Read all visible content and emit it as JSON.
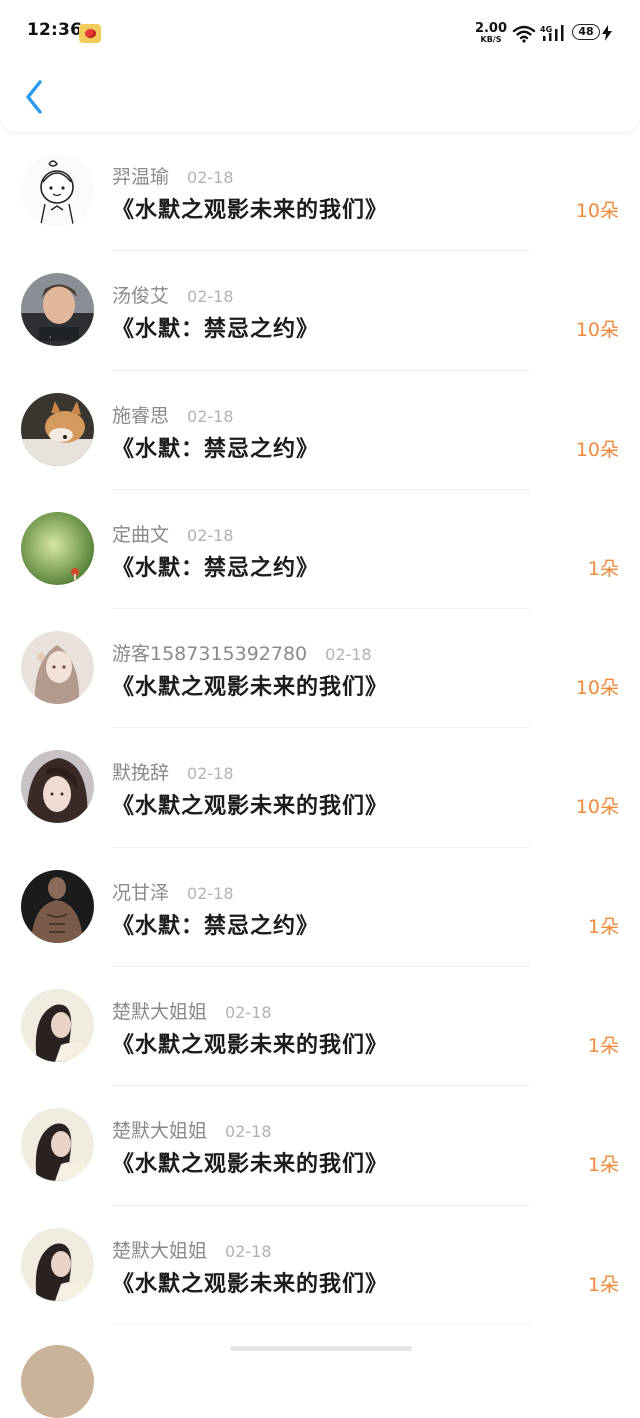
{
  "status_bar": {
    "time": "12:36",
    "app_icon": "weibo-icon",
    "net_speed": "2.00",
    "net_speed_unit": "KB/S",
    "network_label": "4G",
    "battery": "48"
  },
  "nav": {
    "back_icon": "chevron-left-icon",
    "accent": "#2a9af0"
  },
  "amount_color": "#f08a3c",
  "items": [
    {
      "name": "羿温瑜",
      "date": "02-18",
      "title": "《水默之观影未来的我们》",
      "amount": "10朵"
    },
    {
      "name": "汤俊艾",
      "date": "02-18",
      "title": "《水默：禁忌之约》",
      "amount": "10朵"
    },
    {
      "name": "施睿思",
      "date": "02-18",
      "title": "《水默：禁忌之约》",
      "amount": "10朵"
    },
    {
      "name": "定曲文",
      "date": "02-18",
      "title": "《水默：禁忌之约》",
      "amount": "1朵"
    },
    {
      "name": "游客1587315392780",
      "date": "02-18",
      "title": "《水默之观影未来的我们》",
      "amount": "10朵"
    },
    {
      "name": "默挽辞",
      "date": "02-18",
      "title": "《水默之观影未来的我们》",
      "amount": "10朵"
    },
    {
      "name": "况甘泽",
      "date": "02-18",
      "title": "《水默：禁忌之约》",
      "amount": "1朵"
    },
    {
      "name": "楚默大姐姐",
      "date": "02-18",
      "title": "《水默之观影未来的我们》",
      "amount": "1朵"
    },
    {
      "name": "楚默大姐姐",
      "date": "02-18",
      "title": "《水默之观影未来的我们》",
      "amount": "1朵"
    },
    {
      "name": "楚默大姐姐",
      "date": "02-18",
      "title": "《水默之观影未来的我们》",
      "amount": "1朵"
    }
  ]
}
